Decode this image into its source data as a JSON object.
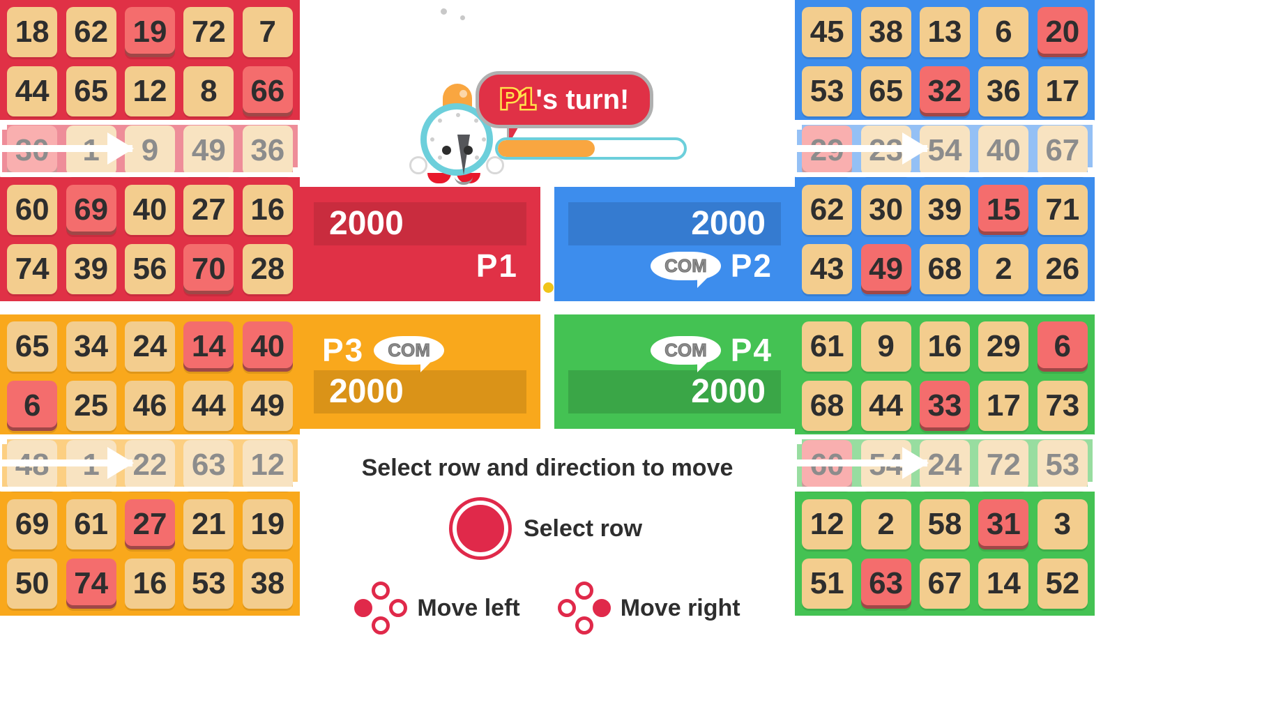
{
  "turn_banner": {
    "player_tag": "P1",
    "suffix": "'s turn!",
    "timer_percent": 52
  },
  "help": {
    "title": "Select row and direction to move",
    "select_row_label": "Select row",
    "move_left_label": "Move left",
    "move_right_label": "Move right"
  },
  "players": [
    {
      "id": "p1",
      "name": "P1",
      "score": "2000",
      "is_com": false,
      "com_label": "",
      "color": "#e03146",
      "selected_row_index": 2,
      "grid": [
        [
          "18",
          "62",
          "19",
          "72",
          "7"
        ],
        [
          "44",
          "65",
          "12",
          "8",
          "66"
        ],
        [
          "30",
          "1",
          "9",
          "49",
          "36"
        ],
        [
          "60",
          "69",
          "40",
          "27",
          "16"
        ],
        [
          "74",
          "39",
          "56",
          "70",
          "28"
        ]
      ],
      "marked": [
        [
          false,
          false,
          true,
          false,
          false
        ],
        [
          false,
          false,
          false,
          false,
          true
        ],
        [
          true,
          false,
          false,
          false,
          false
        ],
        [
          false,
          true,
          false,
          false,
          false
        ],
        [
          false,
          false,
          false,
          true,
          false
        ]
      ]
    },
    {
      "id": "p2",
      "name": "P2",
      "score": "2000",
      "is_com": true,
      "com_label": "COM",
      "color": "#3d8ded",
      "selected_row_index": 2,
      "grid": [
        [
          "45",
          "38",
          "13",
          "6",
          "20"
        ],
        [
          "53",
          "65",
          "32",
          "36",
          "17"
        ],
        [
          "29",
          "23",
          "54",
          "40",
          "67"
        ],
        [
          "62",
          "30",
          "39",
          "15",
          "71"
        ],
        [
          "43",
          "49",
          "68",
          "2",
          "26"
        ]
      ],
      "marked": [
        [
          false,
          false,
          false,
          false,
          true
        ],
        [
          false,
          false,
          true,
          false,
          false
        ],
        [
          true,
          false,
          false,
          false,
          false
        ],
        [
          false,
          false,
          false,
          true,
          false
        ],
        [
          false,
          true,
          false,
          false,
          false
        ]
      ]
    },
    {
      "id": "p3",
      "name": "P3",
      "score": "2000",
      "is_com": true,
      "com_label": "COM",
      "color": "#f9a81c",
      "selected_row_index": 2,
      "grid": [
        [
          "65",
          "34",
          "24",
          "14",
          "40"
        ],
        [
          "6",
          "25",
          "46",
          "44",
          "49"
        ],
        [
          "48",
          "1",
          "22",
          "63",
          "12"
        ],
        [
          "69",
          "61",
          "27",
          "21",
          "19"
        ],
        [
          "50",
          "74",
          "16",
          "53",
          "38"
        ]
      ],
      "marked": [
        [
          false,
          false,
          false,
          true,
          true
        ],
        [
          true,
          false,
          false,
          false,
          false
        ],
        [
          false,
          false,
          false,
          false,
          false
        ],
        [
          false,
          false,
          true,
          false,
          false
        ],
        [
          false,
          true,
          false,
          false,
          false
        ]
      ]
    },
    {
      "id": "p4",
      "name": "P4",
      "score": "2000",
      "is_com": true,
      "com_label": "COM",
      "color": "#44c253",
      "selected_row_index": 2,
      "grid": [
        [
          "61",
          "9",
          "16",
          "29",
          "6"
        ],
        [
          "68",
          "44",
          "33",
          "17",
          "73"
        ],
        [
          "60",
          "54",
          "24",
          "72",
          "53"
        ],
        [
          "12",
          "2",
          "58",
          "31",
          "3"
        ],
        [
          "51",
          "63",
          "67",
          "14",
          "52"
        ]
      ],
      "marked": [
        [
          false,
          false,
          false,
          false,
          true
        ],
        [
          false,
          false,
          true,
          false,
          false
        ],
        [
          true,
          false,
          false,
          false,
          false
        ],
        [
          false,
          false,
          false,
          true,
          false
        ],
        [
          false,
          true,
          false,
          false,
          false
        ]
      ]
    }
  ]
}
